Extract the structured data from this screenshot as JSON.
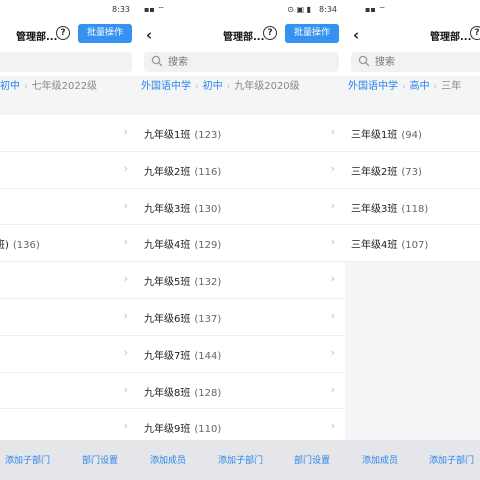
{
  "status_bar": {
    "time_1": "8:33",
    "time_2": "8:34",
    "icons_left": "▪▪ ⌔",
    "icons_right": "⊙ ▣ ▮"
  },
  "header": {
    "title": "管理部...",
    "help_symbol": "?",
    "batch_label": "批量操作",
    "back_symbol": "‹"
  },
  "search": {
    "placeholder": "搜索"
  },
  "panels": [
    {
      "breadcrumbs": [
        "初中",
        "七年级2022级"
      ],
      "rows": [
        {
          "label": "",
          "count": ""
        },
        {
          "label": "",
          "count": ""
        },
        {
          "label": "",
          "count": ""
        },
        {
          "label": "班)",
          "count": "(136)"
        },
        {
          "label": "",
          "count": ""
        },
        {
          "label": "",
          "count": ""
        },
        {
          "label": "",
          "count": ""
        },
        {
          "label": "",
          "count": ""
        },
        {
          "label": "",
          "count": ""
        }
      ],
      "footer": {
        "add_sub": "添加子部门",
        "settings": "部门设置"
      }
    },
    {
      "breadcrumbs": [
        "外国语中学",
        "初中",
        "九年级2020级"
      ],
      "rows": [
        {
          "label": "九年级1班",
          "count": "(123)"
        },
        {
          "label": "九年级2班",
          "count": "(116)"
        },
        {
          "label": "九年级3班",
          "count": "(130)"
        },
        {
          "label": "九年级4班",
          "count": "(129)"
        },
        {
          "label": "九年级5班",
          "count": "(132)"
        },
        {
          "label": "九年级6班",
          "count": "(137)"
        },
        {
          "label": "九年级7班",
          "count": "(144)"
        },
        {
          "label": "九年级8班",
          "count": "(128)"
        },
        {
          "label": "九年级9班",
          "count": "(110)"
        }
      ],
      "footer": {
        "add_member": "添加成员",
        "add_sub": "添加子部门",
        "settings": "部门设置"
      }
    },
    {
      "breadcrumbs": [
        "外国语中学",
        "高中",
        "三年"
      ],
      "rows": [
        {
          "label": "三年级1班",
          "count": "(94)"
        },
        {
          "label": "三年级2班",
          "count": "(73)"
        },
        {
          "label": "三年级3班",
          "count": "(118)"
        },
        {
          "label": "三年级4班",
          "count": "(107)"
        }
      ],
      "footer": {
        "add_member": "添加成员",
        "add_sub": "添加子部门"
      }
    }
  ],
  "colors": {
    "accent": "#3592f0",
    "link": "#2a84e8",
    "background": "#f4f5f7"
  }
}
